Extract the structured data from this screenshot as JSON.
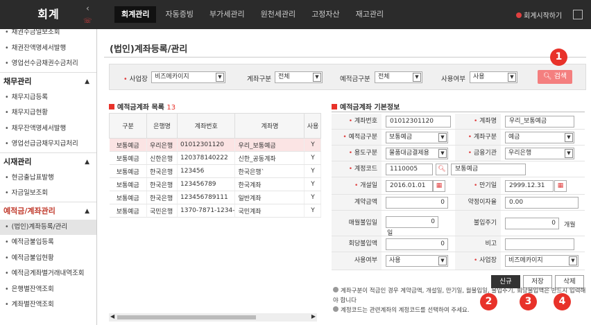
{
  "app": {
    "brand": "회계",
    "collapse_glyph": "‹",
    "start_link": "회계시작하기"
  },
  "menu": [
    "회계관리",
    "자동증빙",
    "부가세관리",
    "원천세관리",
    "고정자산",
    "재고관리"
  ],
  "sidebar": {
    "group0": [
      "채권수금일보조회",
      "채권잔액명세서발행",
      "영업선수금채권수금처리"
    ],
    "head1": "채무관리",
    "group1": [
      "채무지급등록",
      "채무지급현황",
      "채무잔액명세서발행",
      "영업선급금채무지급처리"
    ],
    "head2": "시재관리",
    "group2": [
      "현금출납표발행",
      "자금일보조회"
    ],
    "head3": "예적금/계좌관리",
    "group3": [
      "(법인)계좌등록/관리",
      "예적금불입등록",
      "예적금불입현황",
      "예적금계좌별거래내역조회",
      "은행별잔액조회",
      "계좌별잔액조회"
    ]
  },
  "page": {
    "title": "(법인)계좌등록/관리"
  },
  "search": {
    "biz_label": "사업장",
    "biz_value": "비즈메카이지",
    "acct_type_label": "계좌구분",
    "acct_type_value": "전체",
    "dep_type_label": "예적금구분",
    "dep_type_value": "전체",
    "use_label": "사용여부",
    "use_value": "사용",
    "button": "검색"
  },
  "list": {
    "title": "예적금계좌 목록",
    "count": "13",
    "headers": [
      "구분",
      "은행명",
      "계좌번호",
      "계좌명",
      "사용"
    ],
    "rows": [
      [
        "보통예금",
        "우리은행",
        "01012301120",
        "우리_보통예금",
        "Y"
      ],
      [
        "보통예금",
        "신한은행",
        "120378140222",
        "신한_공동계좌",
        "Y"
      ],
      [
        "보통예금",
        "한국은행",
        "123456",
        "한국은행`",
        "Y"
      ],
      [
        "보통예금",
        "한국은행",
        "123456789",
        "한국계좌",
        "Y"
      ],
      [
        "보통예금",
        "한국은행",
        "123456789111",
        "일반계좌",
        "Y"
      ],
      [
        "보통예금",
        "국민은행",
        "1370-7871-1234-",
        "국민계좌",
        "Y"
      ]
    ]
  },
  "detail": {
    "title": "예적금계좌 기본정보",
    "acct_no_label": "계좌번호",
    "acct_no": "01012301120",
    "acct_name_label": "계좌명",
    "acct_name": "우리_보통예금",
    "dep_type_label": "예적금구분",
    "dep_type": "보통예금",
    "acct_type_label": "계좌구분",
    "acct_type": "예금",
    "usage_label": "용도구분",
    "usage": "물품대금결제용",
    "fin_label": "금융기관",
    "fin": "우리은행",
    "code_label": "계정코드",
    "code": "1110005",
    "code_name": "보통예금",
    "open_label": "개설일",
    "open": "2016.01.01",
    "mature_label": "만기일",
    "mature": "2999.12.31",
    "contract_label": "계약금액",
    "contract": "0",
    "rate_label": "약정이자율",
    "rate": "0.00",
    "pay_day_label": "매월불입일",
    "pay_day": "0",
    "pay_day_unit": "일",
    "period_label": "불입주기",
    "period": "0",
    "period_unit": "개월",
    "each_label": "회당불입액",
    "each": "0",
    "memo_label": "비고",
    "memo": "",
    "use_label": "사용여부",
    "use": "사용",
    "biz_label": "사업장",
    "biz": "비즈메카이지"
  },
  "buttons": {
    "new": "신규",
    "save": "저장",
    "delete": "삭제"
  },
  "badges": [
    "1",
    "2",
    "3",
    "4"
  ],
  "notes": [
    "계좌구분이 적금인 경우 계약금액, 개설일, 만기일, 월불입일, 불입주기, 회당불입액은 반드시 입력해야 합니다",
    "계정코드는 관련계좌의 계정코드를 선택하여 주세요."
  ]
}
